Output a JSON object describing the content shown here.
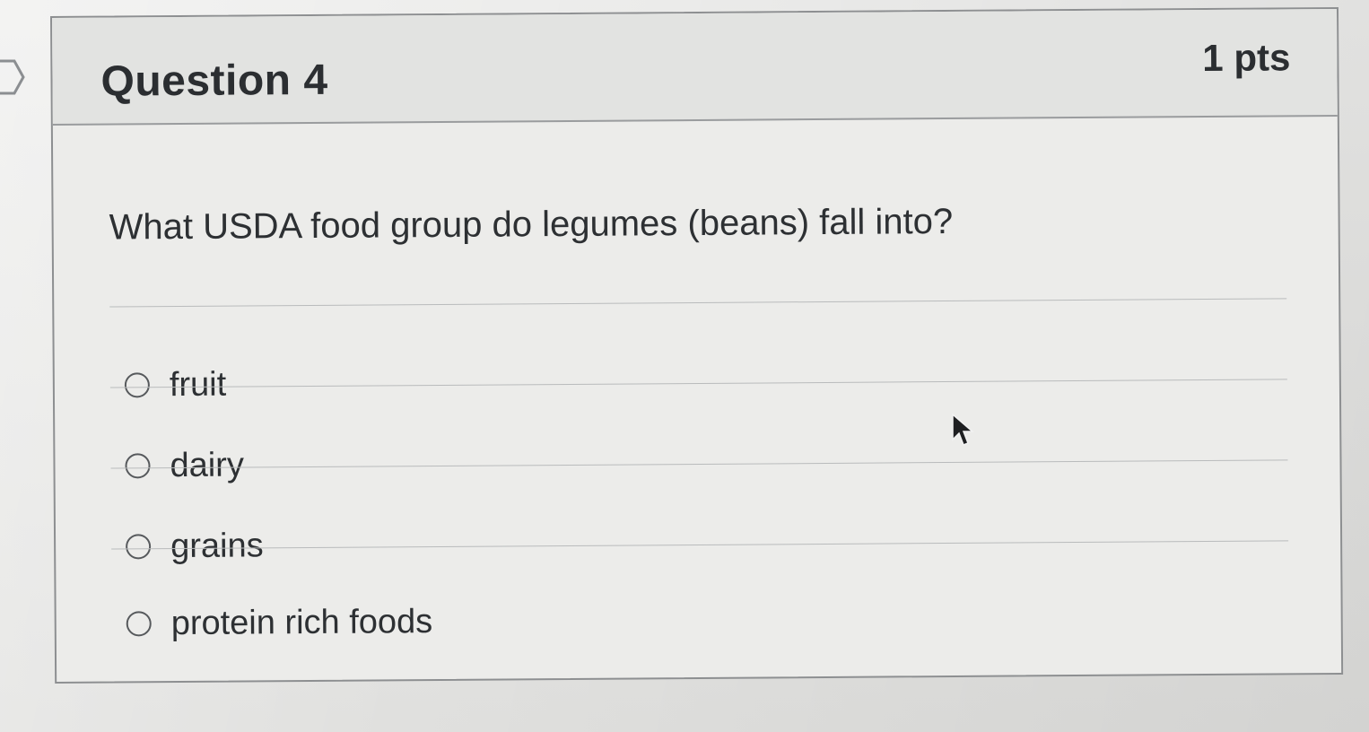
{
  "question": {
    "title": "Question 4",
    "points": "1 pts",
    "text": "What USDA food group do legumes (beans) fall into?",
    "answers": [
      {
        "label": "fruit",
        "selected": false
      },
      {
        "label": "dairy",
        "selected": false
      },
      {
        "label": "grains",
        "selected": false
      },
      {
        "label": "protein rich foods",
        "selected": false
      }
    ]
  },
  "icons": {
    "flag": "flag-marker-icon",
    "radio": "radio-empty-icon",
    "cursor": "pointer-cursor-icon"
  },
  "colors": {
    "text": "#2d3033",
    "border": "#8d8f91",
    "header_bg": "#e2e3e1"
  }
}
